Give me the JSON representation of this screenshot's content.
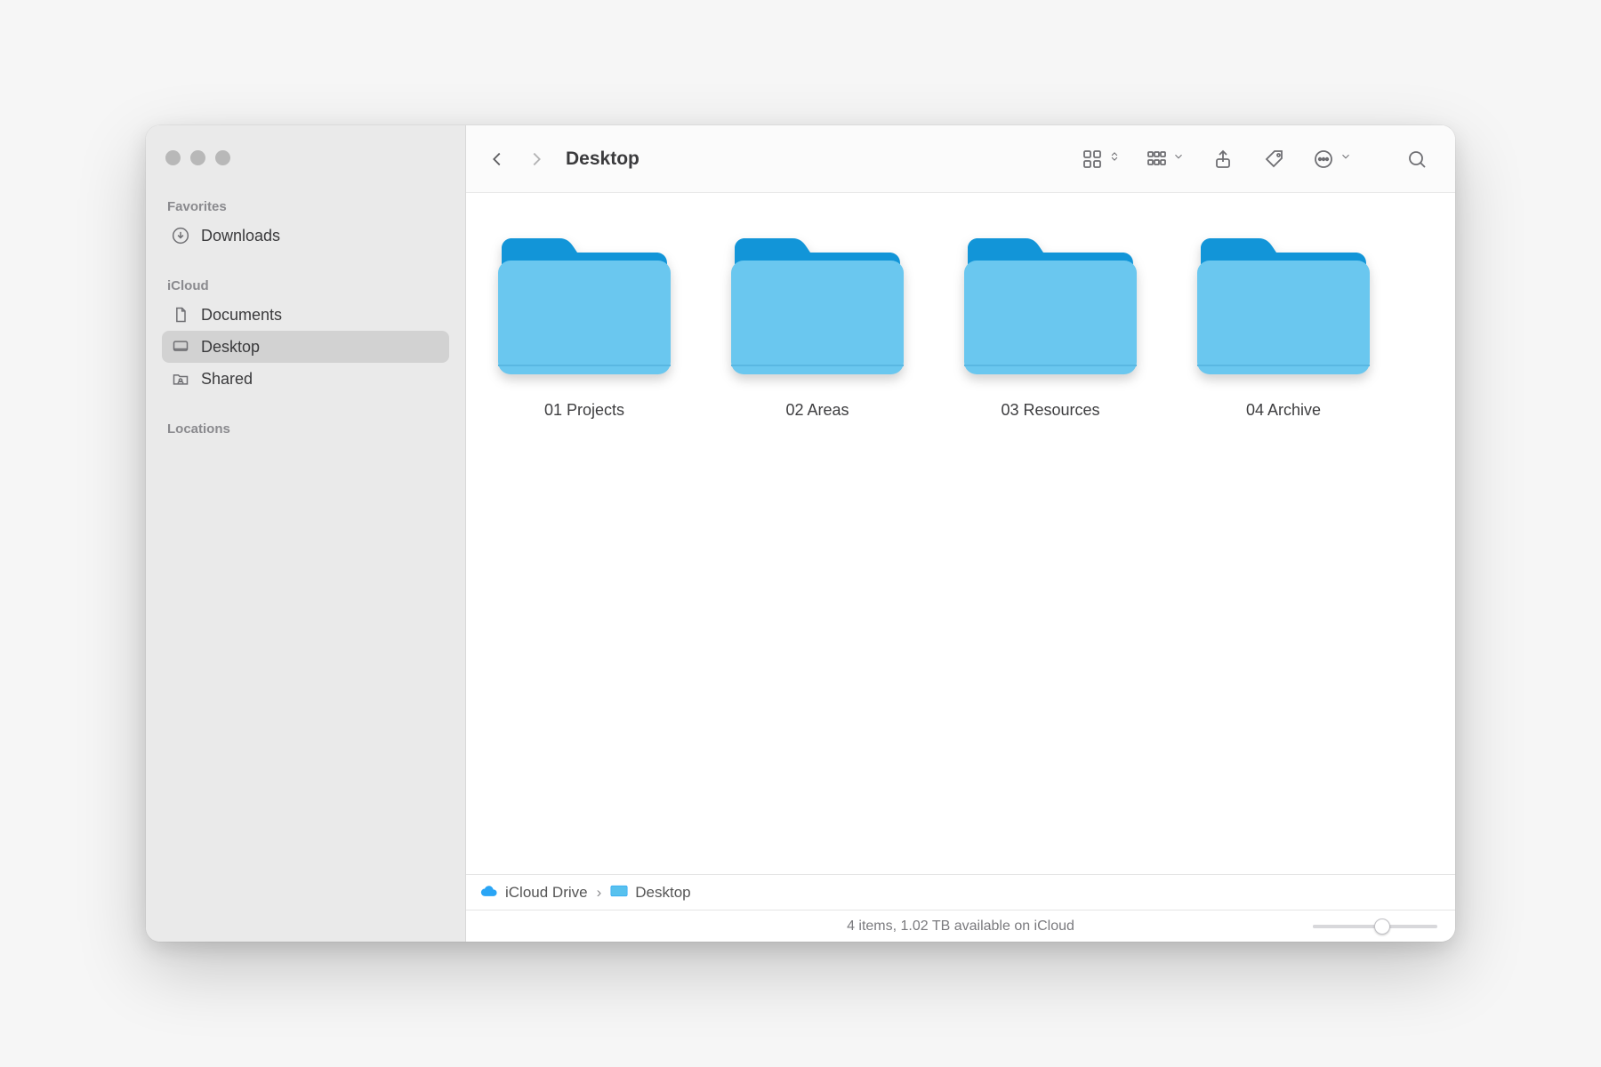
{
  "window_title": "Desktop",
  "sidebar": {
    "sections": [
      {
        "title": "Favorites",
        "items": [
          {
            "label": "Downloads",
            "icon": "download"
          }
        ]
      },
      {
        "title": "iCloud",
        "items": [
          {
            "label": "Documents",
            "icon": "doc"
          },
          {
            "label": "Desktop",
            "icon": "desktop",
            "active": true
          },
          {
            "label": "Shared",
            "icon": "shared"
          }
        ]
      },
      {
        "title": "Locations",
        "items": []
      }
    ]
  },
  "folders": [
    {
      "label": "01 Projects"
    },
    {
      "label": "02 Areas"
    },
    {
      "label": "03 Resources"
    },
    {
      "label": "04 Archive"
    }
  ],
  "pathbar": {
    "segments": [
      {
        "label": "iCloud Drive",
        "icon": "cloud"
      },
      {
        "label": "Desktop",
        "icon": "desktop-small"
      }
    ]
  },
  "status_text": "4 items, 1.02 TB available on iCloud",
  "zoom_percent": 56
}
